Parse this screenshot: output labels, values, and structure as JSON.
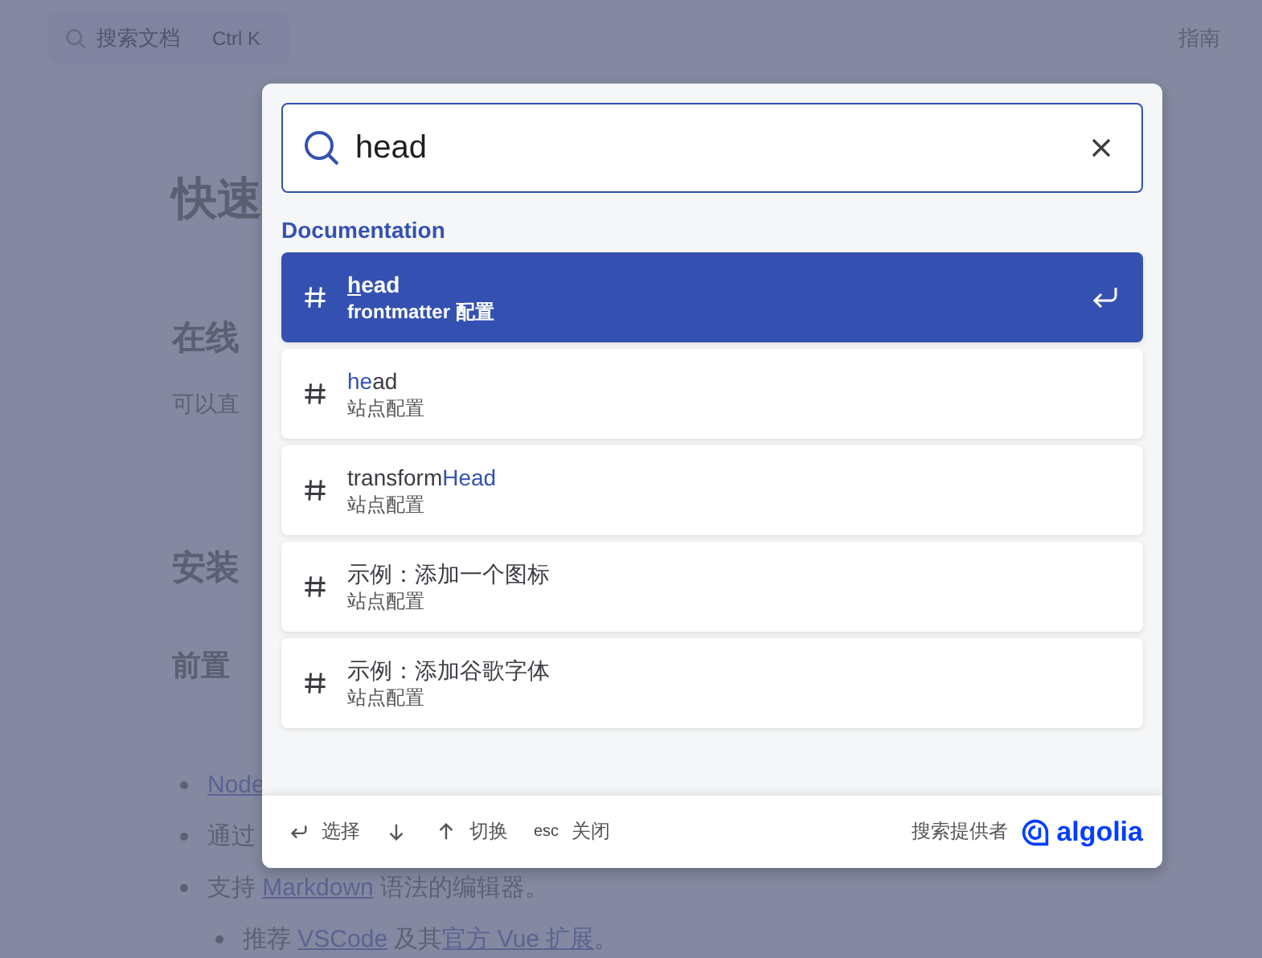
{
  "navbar": {
    "search_button": {
      "placeholder": "搜索文档",
      "shortcut": "Ctrl K"
    },
    "links": [
      "指南"
    ]
  },
  "page": {
    "title": "快速",
    "section_1": "在线",
    "paragraph": "可以直",
    "section_2": "安装",
    "subsection": "前置",
    "bullets": [
      {
        "parts": [
          {
            "text": "Node",
            "link": true
          }
        ]
      },
      {
        "parts": [
          {
            "text": "通过",
            "link": false
          }
        ]
      },
      {
        "parts": [
          {
            "text": "支持 ",
            "link": false
          },
          {
            "text": "Markdown",
            "link": true
          },
          {
            "text": " 语法的编辑器。",
            "link": false
          }
        ],
        "children": [
          {
            "parts": [
              {
                "text": "推荐 ",
                "link": false
              },
              {
                "text": "VSCode",
                "link": true
              },
              {
                "text": " 及其",
                "link": false
              },
              {
                "text": "官方 Vue 扩展",
                "link": true
              },
              {
                "text": "。",
                "link": false
              }
            ]
          }
        ]
      }
    ]
  },
  "search_modal": {
    "query": "head",
    "group": "Documentation",
    "hits": [
      {
        "title": [
          {
            "text": "h",
            "highlighted": true
          },
          {
            "text": "ead",
            "highlighted": false
          }
        ],
        "subtitle": "frontmatter 配置",
        "selected": true
      },
      {
        "title": [
          {
            "text": "he",
            "highlighted": true
          },
          {
            "text": "ad",
            "highlighted": false
          }
        ],
        "subtitle": "站点配置",
        "selected": false
      },
      {
        "title": [
          {
            "text": "transform",
            "highlighted": false
          },
          {
            "text": "Head",
            "highlighted": true
          }
        ],
        "subtitle": "站点配置",
        "selected": false
      },
      {
        "title": [
          {
            "text": "示例：添加一个图标",
            "highlighted": false
          }
        ],
        "subtitle": "站点配置",
        "selected": false
      },
      {
        "title": [
          {
            "text": "示例：添加谷歌字体",
            "highlighted": false
          }
        ],
        "subtitle": "站点配置",
        "selected": false
      }
    ],
    "footer": {
      "commands": [
        {
          "kind": "enter",
          "label": "选择"
        },
        {
          "kind": "arrows",
          "label": "切换"
        },
        {
          "kind": "esc",
          "key": "esc",
          "label": "关闭"
        }
      ],
      "provider_label": "搜索提供者",
      "provider_logo": "algolia"
    }
  }
}
